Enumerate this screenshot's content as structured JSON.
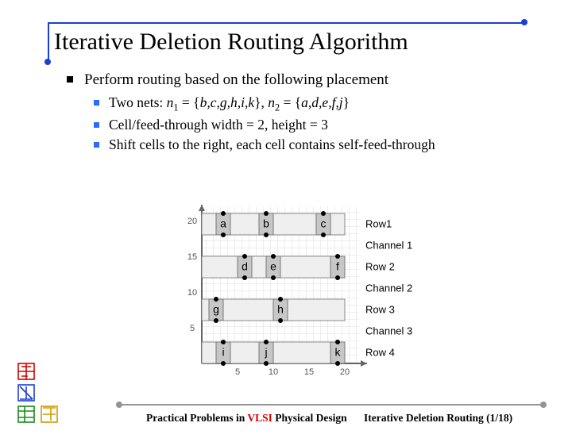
{
  "title": "Iterative Deletion Routing Algorithm",
  "bullets": {
    "l1": "Perform routing based on the following placement",
    "l2a_pre": "Two nets: ",
    "l2a_n1": "n",
    "l2a_n1s": "1",
    "l2a_mid1": " = {",
    "l2a_set1": "b,c,g,h,i,k",
    "l2a_mid2": "}, ",
    "l2a_n2": "n",
    "l2a_n2s": "2",
    "l2a_mid3": " = {",
    "l2a_set2": "a,d,e,f,j",
    "l2a_end": "}",
    "l2b": "Cell/feed-through width = 2, height = 3",
    "l2c": "Shift cells to the right, each cell contains self-feed-through"
  },
  "footer": {
    "left_a": "Practical Problems in ",
    "left_vlsi": "VLSI",
    "left_b": " Physical Design",
    "right": "Iterative Deletion Routing (1/18)"
  },
  "diagram": {
    "ylabels": {
      "t20": "20",
      "t15": "15",
      "t10": "10",
      "t5": "5"
    },
    "xlabels": {
      "x5": "5",
      "x10": "10",
      "x15": "15",
      "x20": "20"
    },
    "rows": {
      "r1": "Row1",
      "c1": "Channel 1",
      "r2": "Row 2",
      "c2": "Channel 2",
      "r3": "Row 3",
      "c3": "Channel 3",
      "r4": "Row 4"
    },
    "cells": {
      "a": "a",
      "b": "b",
      "c": "c",
      "d": "d",
      "e": "e",
      "f": "f",
      "g": "g",
      "h": "h",
      "i": "i",
      "j": "j",
      "k": "k"
    }
  }
}
